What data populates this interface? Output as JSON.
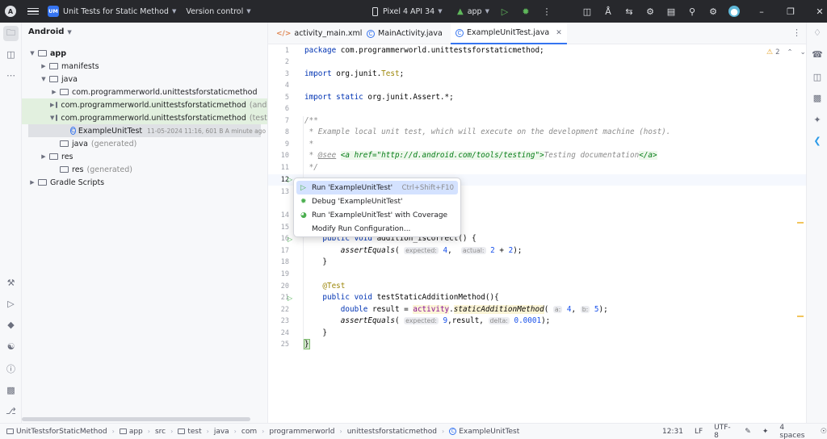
{
  "titlebar": {
    "project_badge": "UM",
    "project_name": "Unit Tests for Static Method",
    "version_control": "Version control",
    "device": "Pixel 4 API 34",
    "run_config": "app"
  },
  "project_panel": {
    "view_mode": "Android",
    "tree": [
      {
        "label": "app",
        "suffix": ""
      },
      {
        "label": "manifests",
        "suffix": ""
      },
      {
        "label": "java",
        "suffix": ""
      },
      {
        "label": "com.programmerworld.unittestsforstaticmethod",
        "suffix": ""
      },
      {
        "label": "com.programmerworld.unittestsforstaticmethod",
        "suffix": "(androidTe"
      },
      {
        "label": "com.programmerworld.unittestsforstaticmethod",
        "suffix": "(test)"
      },
      {
        "label": "ExampleUnitTest",
        "suffix": "",
        "meta": "11-05-2024 11:16, 601 B  A minute ago"
      },
      {
        "label": "java",
        "suffix": "(generated)"
      },
      {
        "label": "res",
        "suffix": ""
      },
      {
        "label": "res",
        "suffix": "(generated)"
      },
      {
        "label": "Gradle Scripts",
        "suffix": ""
      }
    ]
  },
  "tabs": [
    {
      "label": "activity_main.xml",
      "icon": "xml-icon"
    },
    {
      "label": "MainActivity.java",
      "icon": "class-icon"
    },
    {
      "label": "ExampleUnitTest.java",
      "icon": "class-icon",
      "active": true
    }
  ],
  "editor": {
    "warning_count": "2",
    "line_numbers": [
      "1",
      "2",
      "3",
      "4",
      "5",
      "6",
      "7",
      "8",
      "9",
      "10",
      "11",
      "12",
      "13",
      "14",
      "15",
      "16",
      "17",
      "18",
      "19",
      "20",
      "21",
      "22",
      "23",
      "24",
      "25"
    ],
    "current_line": "12"
  },
  "popup": {
    "items": [
      {
        "label": "Run 'ExampleUnitTest'",
        "shortcut": "Ctrl+Shift+F10",
        "icon": "run-icon"
      },
      {
        "label": "Debug 'ExampleUnitTest'",
        "shortcut": "",
        "icon": "debug-icon"
      },
      {
        "label": "Run 'ExampleUnitTest' with Coverage",
        "shortcut": "",
        "icon": "coverage-icon"
      },
      {
        "label": "Modify Run Configuration...",
        "shortcut": "",
        "icon": ""
      }
    ]
  },
  "statusbar": {
    "breadcrumb": [
      "UnitTestsforStaticMethod",
      "app",
      "src",
      "test",
      "java",
      "com",
      "programmerworld",
      "unittestsforstaticmethod",
      "ExampleUnitTest"
    ],
    "position": "12:31",
    "line_sep": "LF",
    "encoding": "UTF-8",
    "indent": "4 spaces"
  },
  "colors": {
    "titlebar_bg": "#27282c",
    "accent": "#3574f0",
    "test_folder_highlight": "#e2f0df",
    "popup_selection": "#d4e2ff"
  }
}
